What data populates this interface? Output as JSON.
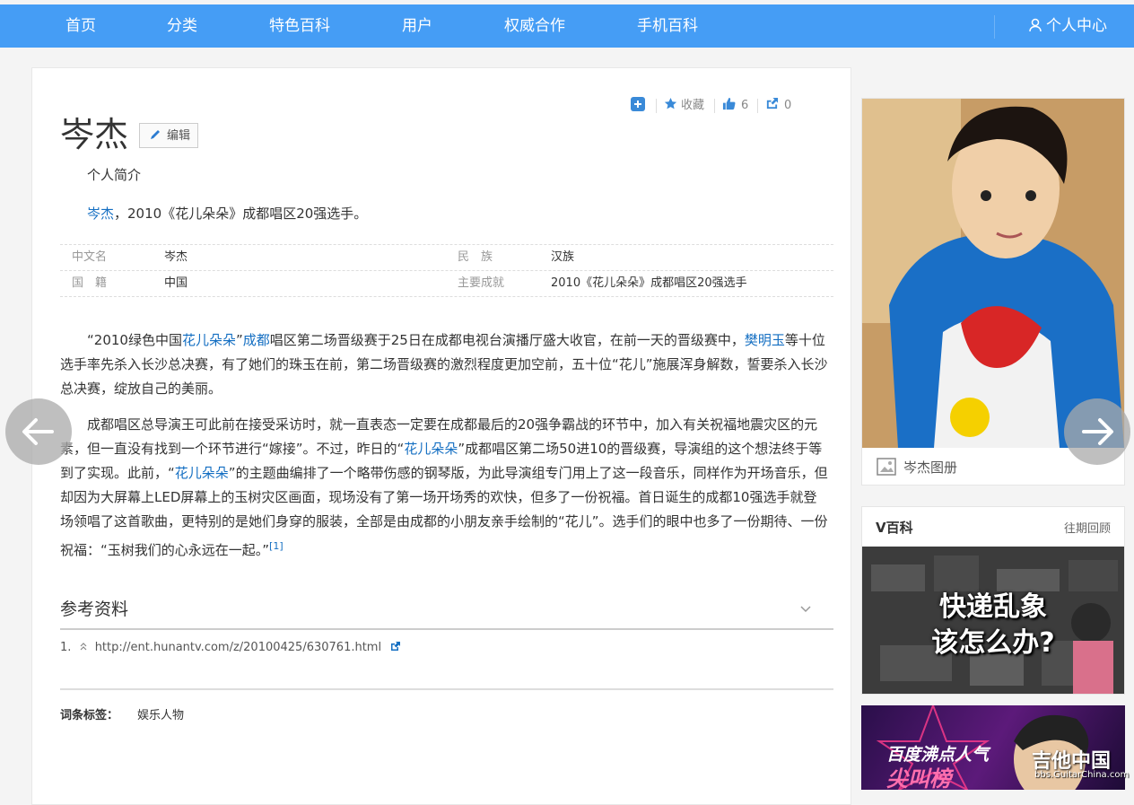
{
  "nav": {
    "items": [
      "首页",
      "分类",
      "特色百科",
      "用户",
      "权威合作",
      "手机百科"
    ],
    "user": "个人中心"
  },
  "entry": {
    "title": "岑杰",
    "edit_label": "编辑",
    "subtitle": "个人简介",
    "summary_link": "岑杰",
    "summary_rest": "，2010《花儿朵朵》成都唱区20强选手。"
  },
  "tools": {
    "collect": "收藏",
    "likes": "6",
    "shares": "0"
  },
  "basic_info": [
    {
      "k1": "中文名",
      "v1": "岑杰",
      "k2": "民　族",
      "v2": "汉族"
    },
    {
      "k1": "国　籍",
      "v1": "中国",
      "k2": "主要成就",
      "v2": "2010《花儿朵朵》成都唱区20强选手"
    }
  ],
  "para1": {
    "t1": "“2010绿色中国",
    "l1": "花儿朵朵",
    "t2": "”",
    "l2": "成都",
    "t3": "唱区第二场晋级赛于25日在成都电视台演播厅盛大收官，在前一天的晋级赛中，",
    "l3": "樊明玉",
    "t4": "等十位选手率先杀入长沙总决赛，有了她们的珠玉在前，第二场晋级赛的激烈程度更加空前，五十位“花儿”施展浑身解数，誓要杀入长沙总决赛，绽放自己的美丽。"
  },
  "para2": {
    "t1": "成都唱区总导演王可此前在接受采访时，就一直表态一定要在成都最后的20强争霸战的环节中，加入有关祝福地震灾区的元素，但一直没有找到一个环节进行“嫁接”。不过，昨日的“",
    "l1": "花儿朵朵",
    "t2": "”成都唱区第二场50进10的晋级赛，导演组的这个想法终于等到了实现。此前，“",
    "l2": "花儿朵朵",
    "t3": "”的主题曲编排了一个略带伤感的钢琴版，为此导演组专门用上了这一段音乐，同样作为开场音乐，但却因为大屏幕上LED屏幕上的玉树灾区画面，现场没有了第一场开场秀的欢快，但多了一份祝福。首日诞生的成都10强选手就登场领唱了这首歌曲，更特别的是她们身穿的服装，全部是由成都的小朋友亲手绘制的“花儿”。选手们的眼中也多了一份期待、一份祝福：“玉树我们的心永远在一起。”",
    "sup": "[1]"
  },
  "references": {
    "title": "参考资料",
    "items": [
      {
        "num": "1.",
        "url": "http://ent.hunantv.com/z/20100425/630761.html"
      }
    ]
  },
  "tags": {
    "label": "词条标签：",
    "value": "娱乐人物"
  },
  "sidebar": {
    "album_label": "岑杰图册",
    "v_title": "V百科",
    "v_more": "往期回顾",
    "v_image_line1": "快递乱象",
    "v_image_line2": "该怎么办?",
    "promo_line1": "百度沸点人气",
    "promo_line2": "尖叫榜"
  },
  "watermark": {
    "name": "吉他中国",
    "site": "bbs.GuitarChina.com"
  }
}
